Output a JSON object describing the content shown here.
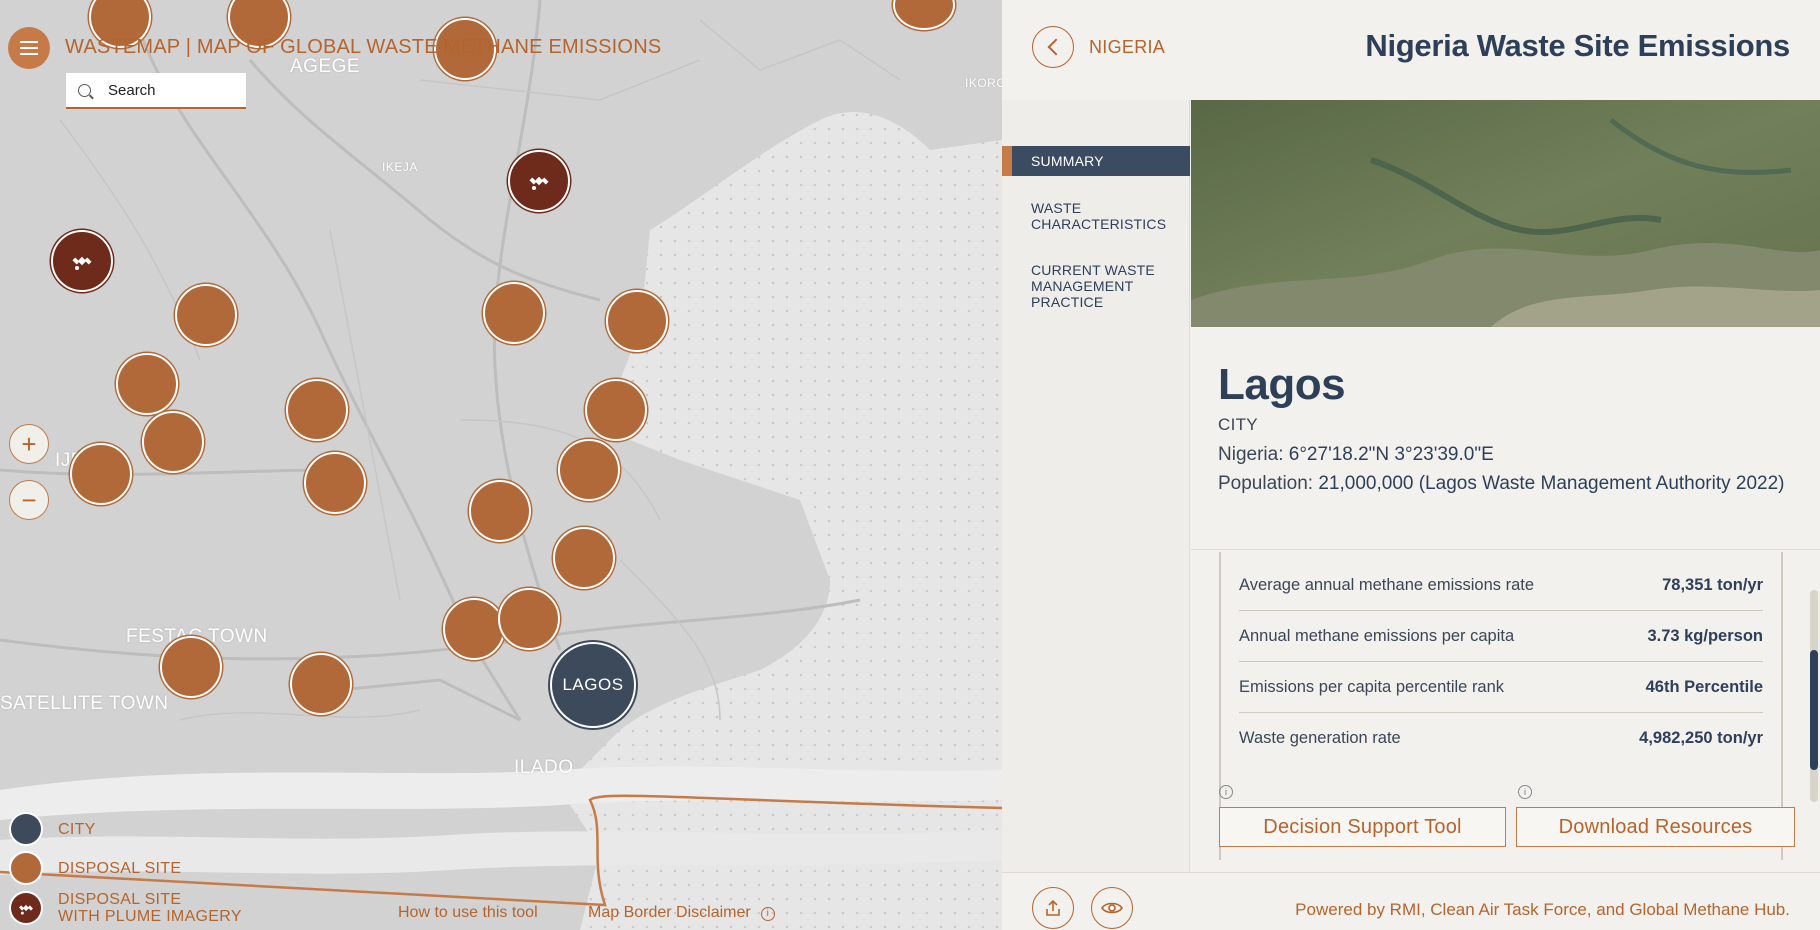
{
  "app": {
    "title": "WASTEMAP | MAP OF GLOBAL WASTE METHANE EMISSIONS",
    "search_placeholder": "Search"
  },
  "map": {
    "labels": {
      "agege": "AGEGE",
      "ikeja": "IKEJA",
      "ikorodu": "IKORODU",
      "ijegun": "IJEGUN",
      "festac_town": "FESTAC TOWN",
      "satellite_town": "SATELLITE TOWN",
      "ilado": "ILADO"
    },
    "city_marker_label": "LAGOS",
    "zoom_in": "+",
    "zoom_out": "−",
    "colors": {
      "city": "#3d4a5c",
      "disposal_site": "#b2693a",
      "plume_site": "#6e2a1a",
      "accent": "#b5642e"
    }
  },
  "legend": {
    "city": "CITY",
    "disposal_site": "DISPOSAL SITE",
    "plume_line1": "DISPOSAL SITE",
    "plume_line2": "WITH PLUME IMAGERY"
  },
  "footer_links": {
    "how_to": "How to use this tool",
    "disclaimer": "Map Border Disclaimer"
  },
  "panel": {
    "back_label": "NIGERIA",
    "title": "Nigeria Waste Site Emissions",
    "tabs": {
      "summary": "SUMMARY",
      "waste_characteristics": "WASTE CHARACTERISTICS",
      "current_practice": "CURRENT WASTE MANAGEMENT PRACTICE"
    },
    "city": {
      "name": "Lagos",
      "kind": "CITY",
      "coords_label": "Nigeria:",
      "coords_value": "6°27'18.2\"N 3°23'39.0\"E",
      "population_label": "Population:",
      "population_value": "21,000,000 (Lagos Waste Management Authority 2022)"
    },
    "stats": [
      {
        "label": "Average annual methane emissions rate",
        "value": "78,351 ton/yr"
      },
      {
        "label": "Annual methane emissions per capita",
        "value": "3.73 kg/person"
      },
      {
        "label": "Emissions per capita percentile rank",
        "value": "46th Percentile"
      },
      {
        "label": "Waste generation rate",
        "value": "4,982,250 ton/yr"
      }
    ],
    "buttons": {
      "decision": "Decision Support Tool",
      "download": "Download Resources"
    },
    "powered_by": "Powered by RMI, Clean Air Task Force, and Global Methane Hub."
  }
}
